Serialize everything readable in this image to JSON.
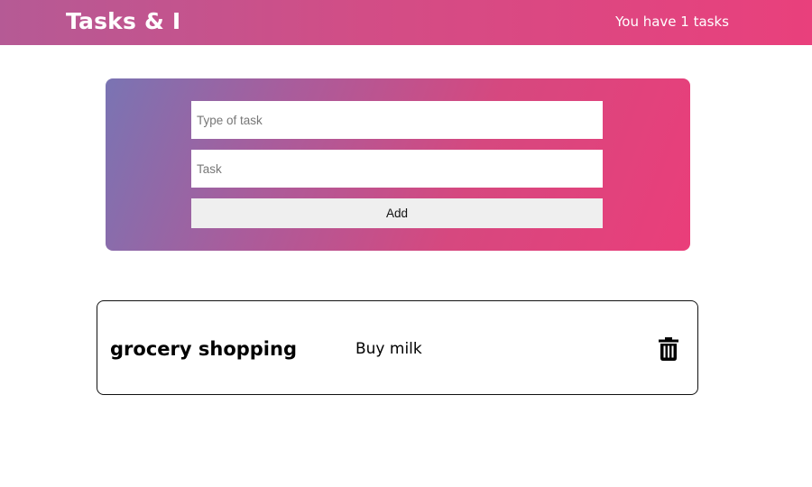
{
  "header": {
    "brand": "Tasks & I",
    "task_count": "You have 1 tasks"
  },
  "form": {
    "type_placeholder": "Type of task",
    "type_value": "",
    "task_placeholder": "Task",
    "task_value": "",
    "add_label": "Add"
  },
  "tasks": [
    {
      "type": "grocery shopping",
      "text": "Buy milk",
      "delete_icon": "trash-icon"
    }
  ],
  "colors": {
    "header_gradient_start": "#b55a95",
    "header_gradient_end": "#e9407c",
    "card_gradient_start": "#7a74b3",
    "card_gradient_end": "#ea3e7a",
    "button_bg": "#efefef"
  }
}
